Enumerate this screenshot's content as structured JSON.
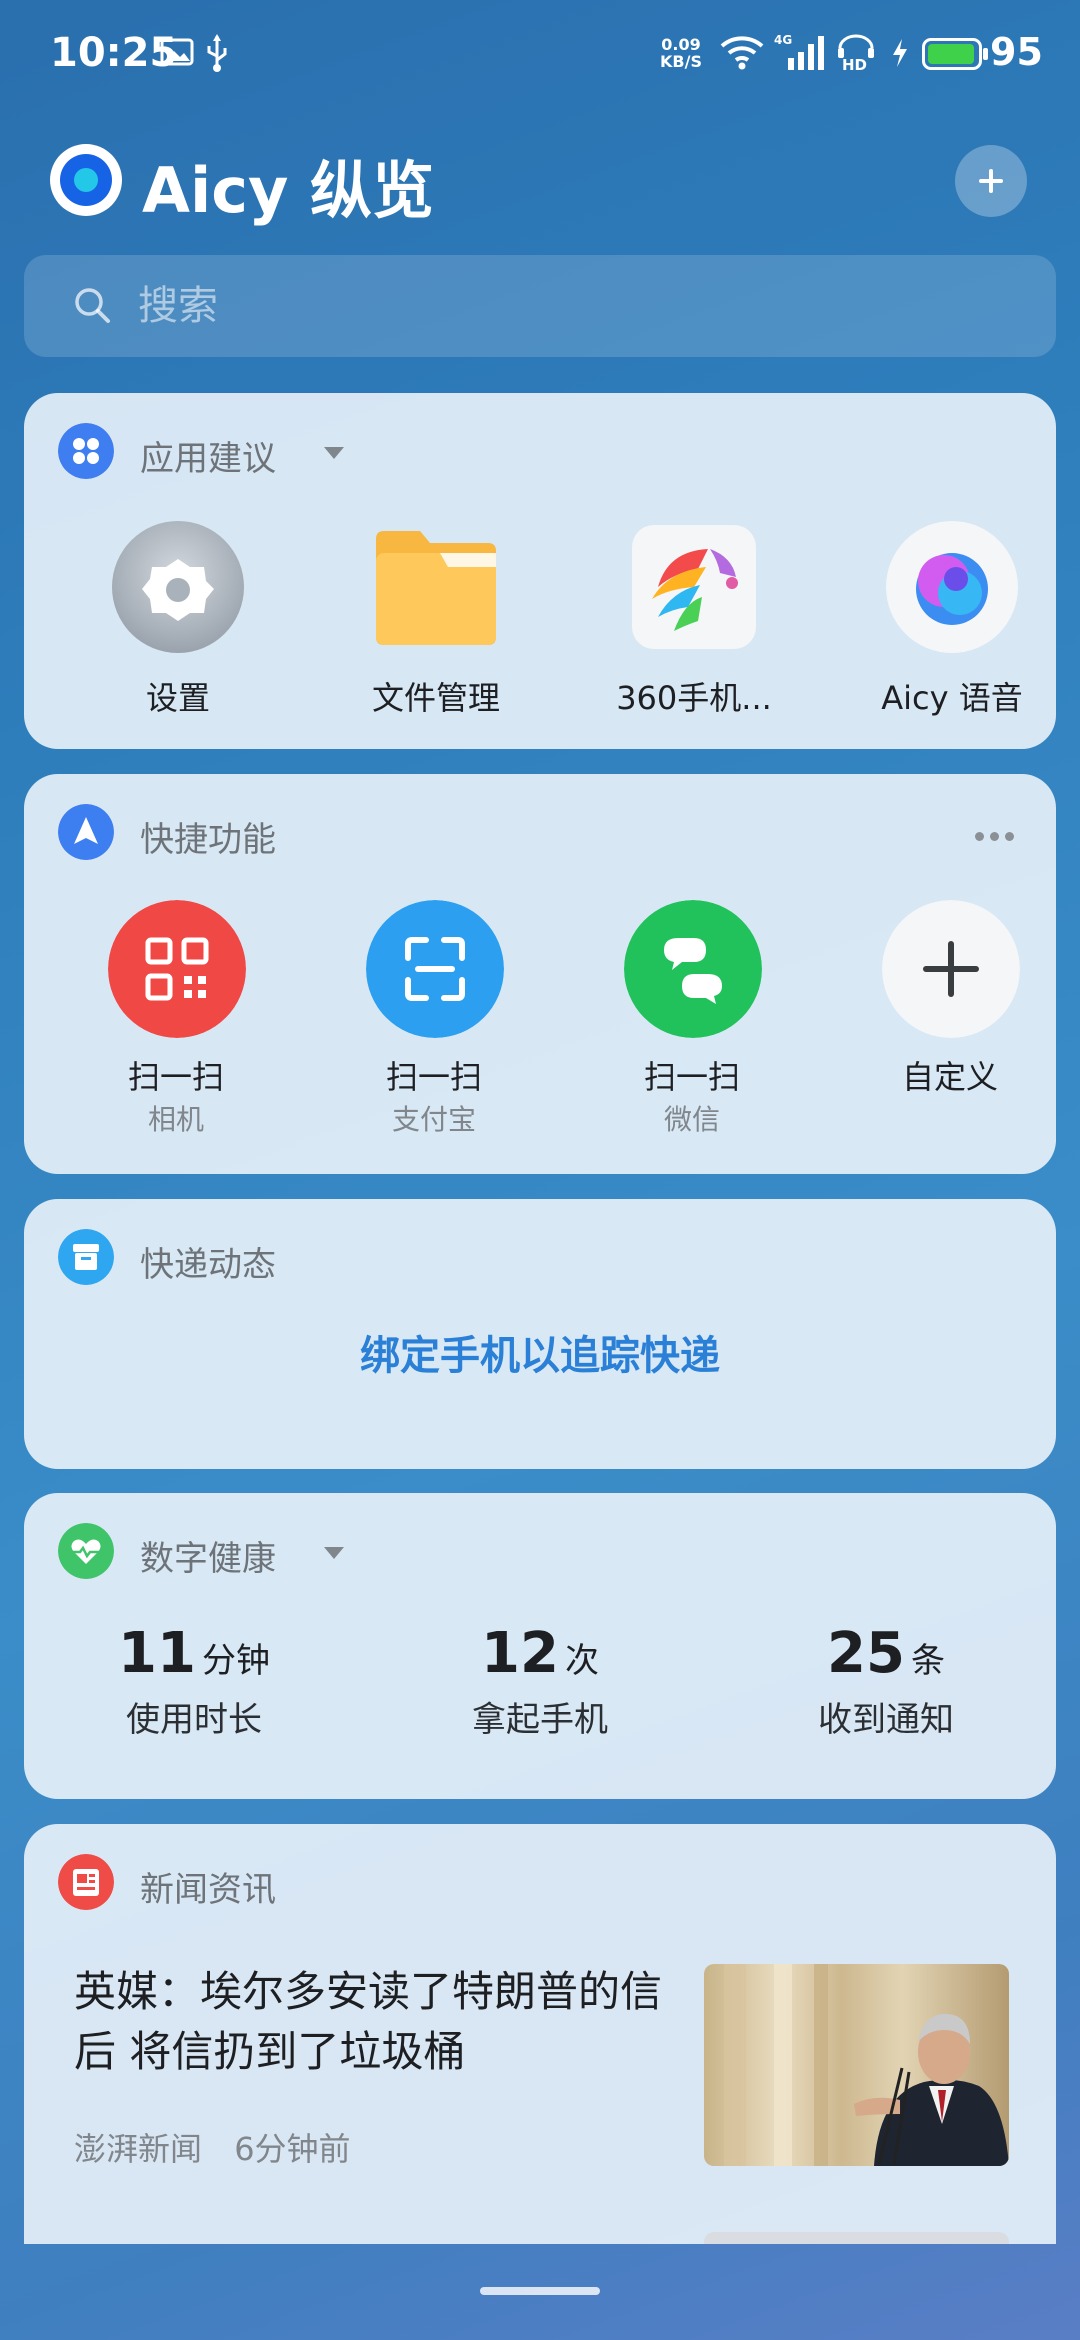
{
  "status_bar": {
    "time": "10:25",
    "net_speed_value": "0.09",
    "net_speed_unit": "KB/S",
    "network": "4G",
    "hd": "HD",
    "battery_level": 95,
    "battery_text": "95",
    "icons": [
      "image-icon",
      "usb-icon",
      "wifi-icon",
      "signal-icon",
      "hd-icon",
      "charging-icon",
      "battery-icon"
    ]
  },
  "header": {
    "title": "Aicy 纵览"
  },
  "search": {
    "placeholder": "搜索"
  },
  "app_suggestions": {
    "title": "应用建议",
    "apps": [
      {
        "label": "设置",
        "icon": "settings-icon"
      },
      {
        "label": "文件管理",
        "icon": "folder-icon"
      },
      {
        "label": "360手机...",
        "icon": "360-app-icon"
      },
      {
        "label": "Aicy 语音",
        "icon": "aicy-voice-icon"
      }
    ]
  },
  "quick_functions": {
    "title": "快捷功能",
    "items": [
      {
        "label": "扫一扫",
        "sub": "相机",
        "icon": "qr-code-icon",
        "color": "#ee4a47"
      },
      {
        "label": "扫一扫",
        "sub": "支付宝",
        "icon": "scan-frame-icon",
        "color": "#1f9bf0"
      },
      {
        "label": "扫一扫",
        "sub": "微信",
        "icon": "wechat-scan-icon",
        "color": "#1fc05a"
      },
      {
        "label": "自定义",
        "sub": "",
        "icon": "plus-icon",
        "color": "#f3f5f7"
      }
    ]
  },
  "express": {
    "title": "快递动态",
    "link": "绑定手机以追踪快递"
  },
  "digital_health": {
    "title": "数字健康",
    "stats": [
      {
        "value": "11",
        "unit": "分钟",
        "label": "使用时长"
      },
      {
        "value": "12",
        "unit": "次",
        "label": "拿起手机"
      },
      {
        "value": "25",
        "unit": "条",
        "label": "收到通知"
      }
    ]
  },
  "news": {
    "title": "新闻资讯",
    "articles": [
      {
        "headline": "英媒：埃尔多安读了特朗普的信后 将信扔到了垃圾桶",
        "source": "澎湃新闻",
        "time": "6分钟前"
      }
    ]
  },
  "colors": {
    "accent_link": "#2a7fd6",
    "background_top": "#2a6fae"
  }
}
